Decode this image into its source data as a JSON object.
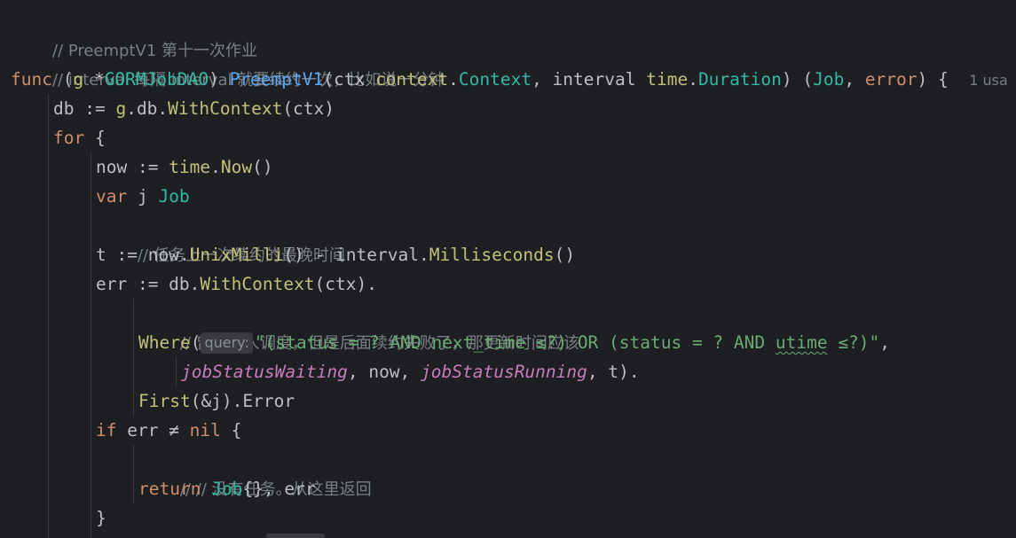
{
  "editor": {
    "usages_hint": "1 usa",
    "param_hint": "query:",
    "lines": {
      "l1_comment": "// PreemptV1 第十一次作业",
      "l2_comment": "// interval 每隔 interval 就要续约一次，比如说一分钟",
      "l3": {
        "func": "func",
        "open": " (",
        "recv": "g",
        "star": " *",
        "recv_type": "GORMJobDAO",
        "close": ") ",
        "name": "PreemptV1",
        "p1": "(ctx ",
        "pkg1": "context",
        "dot1": ".",
        "type1": "Context",
        "p2": ", interval ",
        "pkg2": "time",
        "dot2": ".",
        "type2": "Duration",
        "p3": ") (",
        "ret1": "Job",
        "p4": ", ",
        "ret2": "error",
        "p5": ") {"
      },
      "l4": {
        "a": "db := ",
        "recv": "g",
        "b": ".db.",
        "call": "WithContext",
        "c": "(ctx)"
      },
      "l5": {
        "kw": "for",
        "b": " {"
      },
      "l6": {
        "a": "now := ",
        "pkg": "time",
        "dot": ".",
        "call": "Now",
        "b": "()"
      },
      "l7": {
        "kw": "var",
        "a": " j ",
        "ty": "Job"
      },
      "l8_comment": "// 任务上一次续约的最晚时间",
      "l9": {
        "a": "t := now.",
        "call1": "UnixMilli",
        "b": "() - interval.",
        "call2": "Milliseconds",
        "c": "()"
      },
      "l10": {
        "a": "err := db.",
        "call": "WithContext",
        "b": "(ctx)."
      },
      "l11_comment": "// 曾经有人调度，但是后面续约失败了，那更新时间应该",
      "l12": {
        "call": "Where",
        "open": "(",
        "str1": "\"(status = ? AND next_time ≤?) OR (status = ? AND ",
        "str_wavy": "utime",
        "str2": " ≤?)\"",
        "end": ","
      },
      "l13": {
        "c1": "jobStatusWaiting",
        "a": ", now, ",
        "c2": "jobStatusRunning",
        "b": ", t)."
      },
      "l14": {
        "call": "First",
        "a": "(&j).Error"
      },
      "l15": {
        "kw1": "if",
        "a": " err ≠ ",
        "kw2": "nil",
        "b": " {"
      },
      "l16_comment": "// // 没有任务。从这里返回",
      "l17": {
        "kw": "return",
        "sp": " ",
        "ty": "Job",
        "a": "{}, err"
      },
      "l18": "}"
    }
  },
  "colors": {
    "background": "#1e1f22",
    "keyword": "#cf8e6d",
    "function": "#56a8f5",
    "call": "#c2c07a",
    "string": "#6aab73",
    "constant": "#c77dbb",
    "comment": "#7a7e85",
    "text": "#bcbec4"
  }
}
